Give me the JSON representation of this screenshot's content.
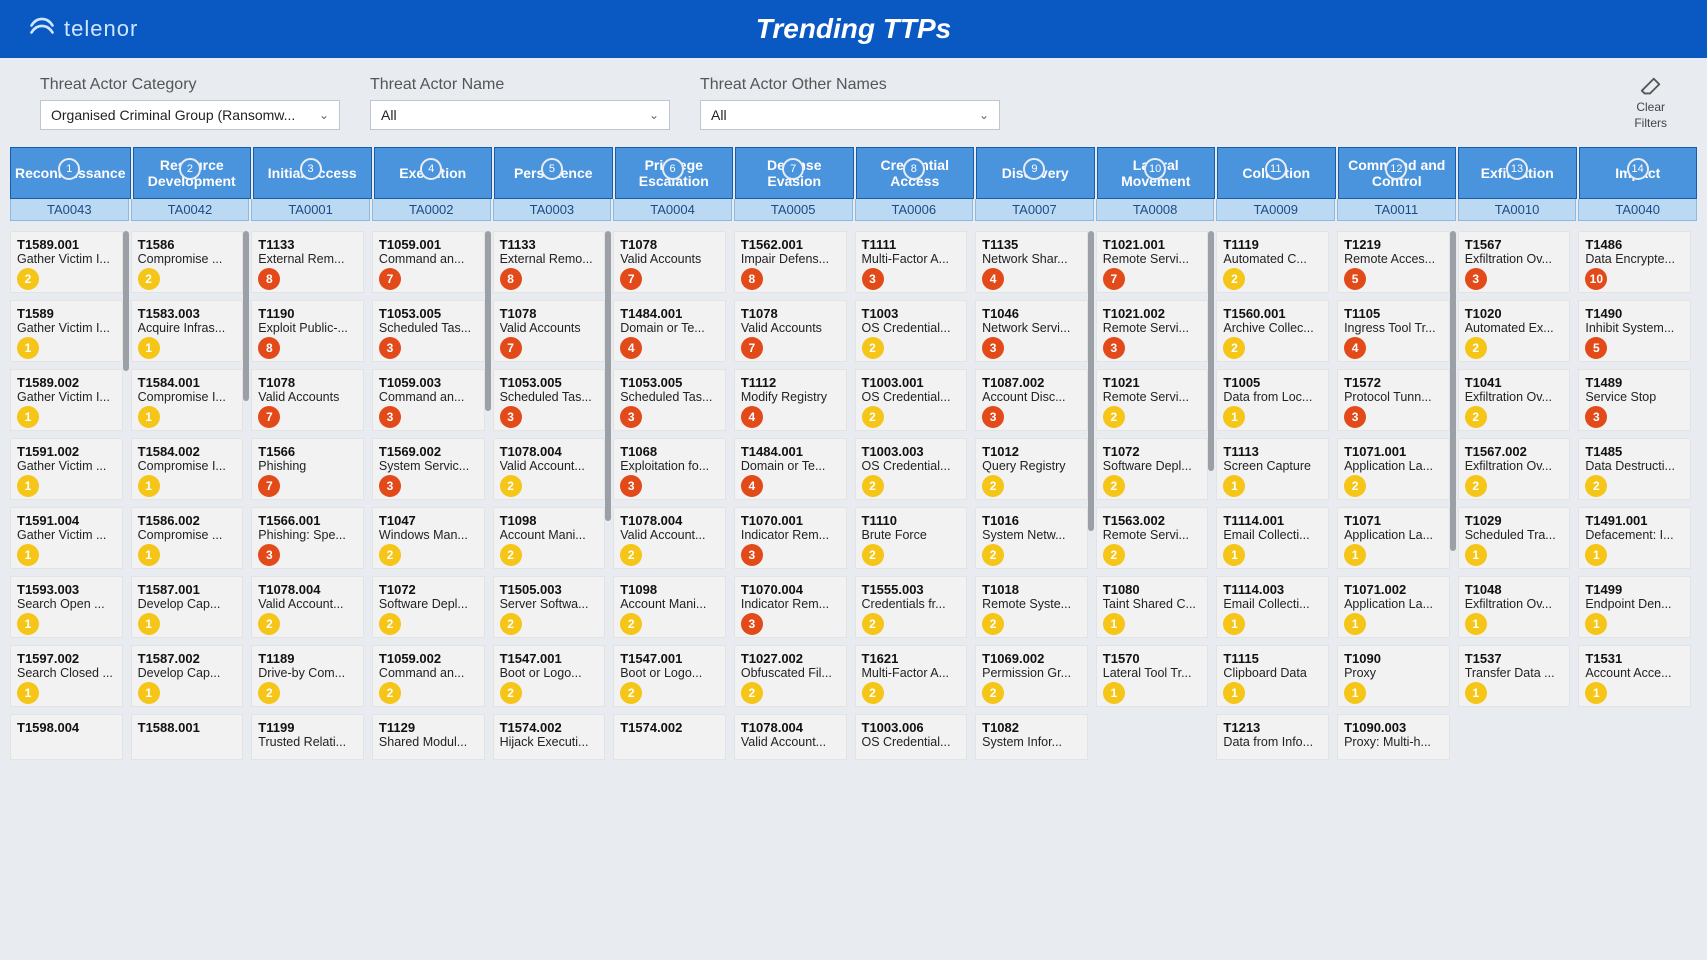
{
  "brand": {
    "name": "telenor"
  },
  "title": "Trending TTPs",
  "filters": {
    "category_label": "Threat Actor Category",
    "category_value": "Organised Criminal Group (Ransomw...",
    "name_label": "Threat Actor Name",
    "name_value": "All",
    "other_label": "Threat Actor Other Names",
    "other_value": "All",
    "clear_line1": "Clear",
    "clear_line2": "Filters"
  },
  "tactics": [
    {
      "num": "1",
      "label": "Reconnaissance",
      "code": "TA0043"
    },
    {
      "num": "2",
      "label": "Resource Development",
      "code": "TA0042"
    },
    {
      "num": "3",
      "label": "Initial Access",
      "code": "TA0001"
    },
    {
      "num": "4",
      "label": "Execution",
      "code": "TA0002"
    },
    {
      "num": "5",
      "label": "Persistence",
      "code": "TA0003"
    },
    {
      "num": "6",
      "label": "Privilege Escalation",
      "code": "TA0004"
    },
    {
      "num": "7",
      "label": "Defense Evasion",
      "code": "TA0005"
    },
    {
      "num": "8",
      "label": "Credential Access",
      "code": "TA0006"
    },
    {
      "num": "9",
      "label": "Discovery",
      "code": "TA0007"
    },
    {
      "num": "10",
      "label": "Lateral Movement",
      "code": "TA0008"
    },
    {
      "num": "11",
      "label": "Collection",
      "code": "TA0009"
    },
    {
      "num": "12",
      "label": "Command and Control",
      "code": "TA0011"
    },
    {
      "num": "13",
      "label": "Exfiltration",
      "code": "TA0010"
    },
    {
      "num": "14",
      "label": "Impact",
      "code": "TA0040"
    }
  ],
  "columns": [
    {
      "scroll": 140,
      "items": [
        {
          "id": "T1589.001",
          "name": "Gather Victim I...",
          "n": "2",
          "c": "yellow"
        },
        {
          "id": "T1589",
          "name": "Gather Victim I...",
          "n": "1",
          "c": "yellow"
        },
        {
          "id": "T1589.002",
          "name": "Gather Victim I...",
          "n": "1",
          "c": "yellow"
        },
        {
          "id": "T1591.002",
          "name": "Gather Victim ...",
          "n": "1",
          "c": "yellow"
        },
        {
          "id": "T1591.004",
          "name": "Gather Victim ...",
          "n": "1",
          "c": "yellow"
        },
        {
          "id": "T1593.003",
          "name": "Search Open ...",
          "n": "1",
          "c": "yellow"
        },
        {
          "id": "T1597.002",
          "name": "Search Closed ...",
          "n": "1",
          "c": "yellow"
        },
        {
          "id": "T1598.004",
          "name": "",
          "n": "",
          "c": "",
          "short": true
        }
      ]
    },
    {
      "scroll": 170,
      "items": [
        {
          "id": "T1586",
          "name": "Compromise ...",
          "n": "2",
          "c": "yellow"
        },
        {
          "id": "T1583.003",
          "name": "Acquire Infras...",
          "n": "1",
          "c": "yellow"
        },
        {
          "id": "T1584.001",
          "name": "Compromise I...",
          "n": "1",
          "c": "yellow"
        },
        {
          "id": "T1584.002",
          "name": "Compromise I...",
          "n": "1",
          "c": "yellow"
        },
        {
          "id": "T1586.002",
          "name": "Compromise ...",
          "n": "1",
          "c": "yellow"
        },
        {
          "id": "T1587.001",
          "name": "Develop Cap...",
          "n": "1",
          "c": "yellow"
        },
        {
          "id": "T1587.002",
          "name": "Develop Cap...",
          "n": "1",
          "c": "yellow"
        },
        {
          "id": "T1588.001",
          "name": "",
          "n": "",
          "c": "",
          "short": true
        }
      ]
    },
    {
      "scroll": 0,
      "items": [
        {
          "id": "T1133",
          "name": "External Rem...",
          "n": "8",
          "c": "red"
        },
        {
          "id": "T1190",
          "name": "Exploit Public-...",
          "n": "8",
          "c": "red"
        },
        {
          "id": "T1078",
          "name": "Valid Accounts",
          "n": "7",
          "c": "red"
        },
        {
          "id": "T1566",
          "name": "Phishing",
          "n": "7",
          "c": "red"
        },
        {
          "id": "T1566.001",
          "name": "Phishing: Spe...",
          "n": "3",
          "c": "red"
        },
        {
          "id": "T1078.004",
          "name": "Valid Account...",
          "n": "2",
          "c": "yellow"
        },
        {
          "id": "T1189",
          "name": "Drive-by Com...",
          "n": "2",
          "c": "yellow"
        },
        {
          "id": "T1199",
          "name": "Trusted Relati...",
          "n": "",
          "c": "",
          "short": true
        }
      ]
    },
    {
      "scroll": 180,
      "items": [
        {
          "id": "T1059.001",
          "name": "Command an...",
          "n": "7",
          "c": "red"
        },
        {
          "id": "T1053.005",
          "name": "Scheduled Tas...",
          "n": "3",
          "c": "red"
        },
        {
          "id": "T1059.003",
          "name": "Command an...",
          "n": "3",
          "c": "red"
        },
        {
          "id": "T1569.002",
          "name": "System Servic...",
          "n": "3",
          "c": "red"
        },
        {
          "id": "T1047",
          "name": "Windows Man...",
          "n": "2",
          "c": "yellow"
        },
        {
          "id": "T1072",
          "name": "Software Depl...",
          "n": "2",
          "c": "yellow"
        },
        {
          "id": "T1059.002",
          "name": "Command an...",
          "n": "2",
          "c": "yellow"
        },
        {
          "id": "T1129",
          "name": "Shared Modul...",
          "n": "",
          "c": "",
          "short": true
        }
      ]
    },
    {
      "scroll": 290,
      "items": [
        {
          "id": "T1133",
          "name": "External Remo...",
          "n": "8",
          "c": "red"
        },
        {
          "id": "T1078",
          "name": "Valid Accounts",
          "n": "7",
          "c": "red"
        },
        {
          "id": "T1053.005",
          "name": "Scheduled Tas...",
          "n": "3",
          "c": "red"
        },
        {
          "id": "T1078.004",
          "name": "Valid Account...",
          "n": "2",
          "c": "yellow"
        },
        {
          "id": "T1098",
          "name": "Account Mani...",
          "n": "2",
          "c": "yellow"
        },
        {
          "id": "T1505.003",
          "name": "Server Softwa...",
          "n": "2",
          "c": "yellow"
        },
        {
          "id": "T1547.001",
          "name": "Boot or Logo...",
          "n": "2",
          "c": "yellow"
        },
        {
          "id": "T1574.002",
          "name": "Hijack Executi...",
          "n": "",
          "c": "",
          "short": true
        }
      ]
    },
    {
      "scroll": 0,
      "items": [
        {
          "id": "T1078",
          "name": "Valid Accounts",
          "n": "7",
          "c": "red"
        },
        {
          "id": "T1484.001",
          "name": "Domain or Te...",
          "n": "4",
          "c": "red"
        },
        {
          "id": "T1053.005",
          "name": "Scheduled Tas...",
          "n": "3",
          "c": "red"
        },
        {
          "id": "T1068",
          "name": "Exploitation fo...",
          "n": "3",
          "c": "red"
        },
        {
          "id": "T1078.004",
          "name": "Valid Account...",
          "n": "2",
          "c": "yellow"
        },
        {
          "id": "T1098",
          "name": "Account Mani...",
          "n": "2",
          "c": "yellow"
        },
        {
          "id": "T1547.001",
          "name": "Boot or Logo...",
          "n": "2",
          "c": "yellow"
        },
        {
          "id": "T1574.002",
          "name": "",
          "n": "",
          "c": "",
          "short": true
        }
      ]
    },
    {
      "scroll": 0,
      "items": [
        {
          "id": "T1562.001",
          "name": "Impair Defens...",
          "n": "8",
          "c": "red"
        },
        {
          "id": "T1078",
          "name": "Valid Accounts",
          "n": "7",
          "c": "red"
        },
        {
          "id": "T1112",
          "name": "Modify Registry",
          "n": "4",
          "c": "red"
        },
        {
          "id": "T1484.001",
          "name": "Domain or Te...",
          "n": "4",
          "c": "red"
        },
        {
          "id": "T1070.001",
          "name": "Indicator Rem...",
          "n": "3",
          "c": "red"
        },
        {
          "id": "T1070.004",
          "name": "Indicator Rem...",
          "n": "3",
          "c": "red"
        },
        {
          "id": "T1027.002",
          "name": "Obfuscated Fil...",
          "n": "2",
          "c": "yellow"
        },
        {
          "id": "T1078.004",
          "name": "Valid Account...",
          "n": "",
          "c": "",
          "short": true
        }
      ]
    },
    {
      "scroll": 0,
      "items": [
        {
          "id": "T1111",
          "name": "Multi-Factor A...",
          "n": "3",
          "c": "red"
        },
        {
          "id": "T1003",
          "name": "OS Credential...",
          "n": "2",
          "c": "yellow"
        },
        {
          "id": "T1003.001",
          "name": "OS Credential...",
          "n": "2",
          "c": "yellow"
        },
        {
          "id": "T1003.003",
          "name": "OS Credential...",
          "n": "2",
          "c": "yellow"
        },
        {
          "id": "T1110",
          "name": "Brute Force",
          "n": "2",
          "c": "yellow"
        },
        {
          "id": "T1555.003",
          "name": "Credentials fr...",
          "n": "2",
          "c": "yellow"
        },
        {
          "id": "T1621",
          "name": "Multi-Factor A...",
          "n": "2",
          "c": "yellow"
        },
        {
          "id": "T1003.006",
          "name": "OS Credential...",
          "n": "",
          "c": "",
          "short": true
        }
      ]
    },
    {
      "scroll": 300,
      "items": [
        {
          "id": "T1135",
          "name": "Network Shar...",
          "n": "4",
          "c": "red"
        },
        {
          "id": "T1046",
          "name": "Network Servi...",
          "n": "3",
          "c": "red"
        },
        {
          "id": "T1087.002",
          "name": "Account Disc...",
          "n": "3",
          "c": "red"
        },
        {
          "id": "T1012",
          "name": "Query Registry",
          "n": "2",
          "c": "yellow"
        },
        {
          "id": "T1016",
          "name": "System Netw...",
          "n": "2",
          "c": "yellow"
        },
        {
          "id": "T1018",
          "name": "Remote Syste...",
          "n": "2",
          "c": "yellow"
        },
        {
          "id": "T1069.002",
          "name": "Permission Gr...",
          "n": "2",
          "c": "yellow"
        },
        {
          "id": "T1082",
          "name": "System Infor...",
          "n": "",
          "c": "",
          "short": true
        }
      ]
    },
    {
      "scroll": 240,
      "items": [
        {
          "id": "T1021.001",
          "name": "Remote Servi...",
          "n": "7",
          "c": "red"
        },
        {
          "id": "T1021.002",
          "name": "Remote Servi...",
          "n": "3",
          "c": "red"
        },
        {
          "id": "T1021",
          "name": "Remote Servi...",
          "n": "2",
          "c": "yellow"
        },
        {
          "id": "T1072",
          "name": "Software Depl...",
          "n": "2",
          "c": "yellow"
        },
        {
          "id": "T1563.002",
          "name": "Remote Servi...",
          "n": "2",
          "c": "yellow"
        },
        {
          "id": "T1080",
          "name": "Taint Shared C...",
          "n": "1",
          "c": "yellow"
        },
        {
          "id": "T1570",
          "name": "Lateral Tool Tr...",
          "n": "1",
          "c": "yellow"
        },
        {
          "id": "",
          "name": "",
          "n": "",
          "c": "",
          "short": true,
          "empty": true
        }
      ]
    },
    {
      "scroll": 0,
      "items": [
        {
          "id": "T1119",
          "name": "Automated C...",
          "n": "2",
          "c": "yellow"
        },
        {
          "id": "T1560.001",
          "name": "Archive Collec...",
          "n": "2",
          "c": "yellow"
        },
        {
          "id": "T1005",
          "name": "Data from Loc...",
          "n": "1",
          "c": "yellow"
        },
        {
          "id": "T1113",
          "name": "Screen Capture",
          "n": "1",
          "c": "yellow"
        },
        {
          "id": "T1114.001",
          "name": "Email Collecti...",
          "n": "1",
          "c": "yellow"
        },
        {
          "id": "T1114.003",
          "name": "Email Collecti...",
          "n": "1",
          "c": "yellow"
        },
        {
          "id": "T1115",
          "name": "Clipboard Data",
          "n": "1",
          "c": "yellow"
        },
        {
          "id": "T1213",
          "name": "Data from Info...",
          "n": "",
          "c": "",
          "short": true
        }
      ]
    },
    {
      "scroll": 320,
      "items": [
        {
          "id": "T1219",
          "name": "Remote Acces...",
          "n": "5",
          "c": "red"
        },
        {
          "id": "T1105",
          "name": "Ingress Tool Tr...",
          "n": "4",
          "c": "red"
        },
        {
          "id": "T1572",
          "name": "Protocol Tunn...",
          "n": "3",
          "c": "red"
        },
        {
          "id": "T1071.001",
          "name": "Application La...",
          "n": "2",
          "c": "yellow"
        },
        {
          "id": "T1071",
          "name": "Application La...",
          "n": "1",
          "c": "yellow"
        },
        {
          "id": "T1071.002",
          "name": "Application La...",
          "n": "1",
          "c": "yellow"
        },
        {
          "id": "T1090",
          "name": "Proxy",
          "n": "1",
          "c": "yellow"
        },
        {
          "id": "T1090.003",
          "name": "Proxy: Multi-h...",
          "n": "",
          "c": "",
          "short": true
        }
      ]
    },
    {
      "scroll": 0,
      "items": [
        {
          "id": "T1567",
          "name": "Exfiltration Ov...",
          "n": "3",
          "c": "red"
        },
        {
          "id": "T1020",
          "name": "Automated Ex...",
          "n": "2",
          "c": "yellow"
        },
        {
          "id": "T1041",
          "name": "Exfiltration Ov...",
          "n": "2",
          "c": "yellow"
        },
        {
          "id": "T1567.002",
          "name": "Exfiltration Ov...",
          "n": "2",
          "c": "yellow"
        },
        {
          "id": "T1029",
          "name": "Scheduled Tra...",
          "n": "1",
          "c": "yellow"
        },
        {
          "id": "T1048",
          "name": "Exfiltration Ov...",
          "n": "1",
          "c": "yellow"
        },
        {
          "id": "T1537",
          "name": "Transfer Data ...",
          "n": "1",
          "c": "yellow"
        },
        {
          "id": "",
          "name": "",
          "n": "",
          "c": "",
          "short": true,
          "empty": true
        }
      ]
    },
    {
      "scroll": 0,
      "items": [
        {
          "id": "T1486",
          "name": "Data Encrypte...",
          "n": "10",
          "c": "red"
        },
        {
          "id": "T1490",
          "name": "Inhibit System...",
          "n": "5",
          "c": "red"
        },
        {
          "id": "T1489",
          "name": "Service Stop",
          "n": "3",
          "c": "red"
        },
        {
          "id": "T1485",
          "name": "Data Destructi...",
          "n": "2",
          "c": "yellow"
        },
        {
          "id": "T1491.001",
          "name": "Defacement: I...",
          "n": "1",
          "c": "yellow"
        },
        {
          "id": "T1499",
          "name": "Endpoint Den...",
          "n": "1",
          "c": "yellow"
        },
        {
          "id": "T1531",
          "name": "Account Acce...",
          "n": "1",
          "c": "yellow"
        },
        {
          "id": "",
          "name": "",
          "n": "",
          "c": "",
          "short": true,
          "empty": true
        }
      ]
    }
  ]
}
